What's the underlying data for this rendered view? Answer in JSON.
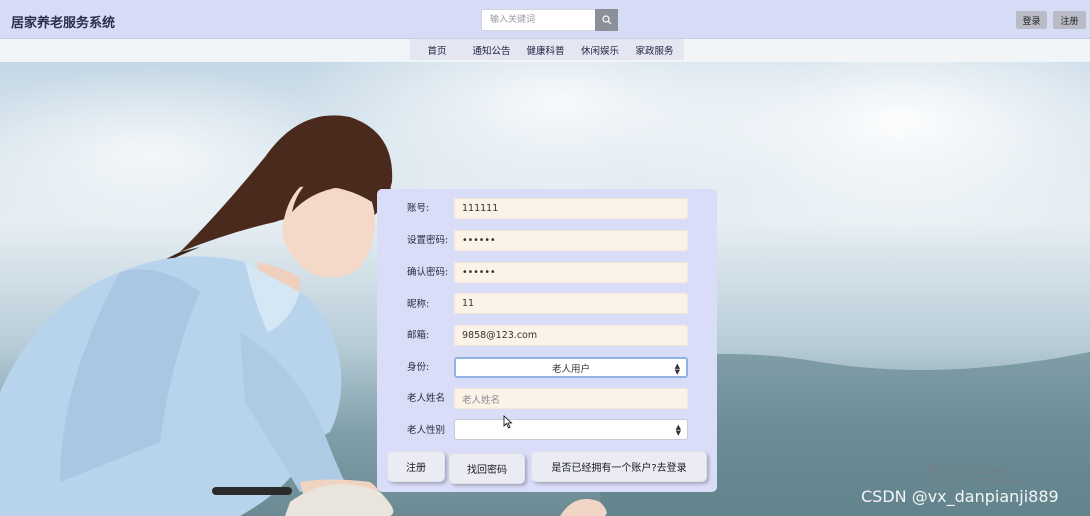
{
  "header": {
    "brand": "居家养老服务系统",
    "search_placeholder": "输入关键词",
    "login_label": "登录",
    "register_label": "注册"
  },
  "nav": {
    "items": [
      {
        "label": "首页"
      },
      {
        "label": "通知公告"
      },
      {
        "label": "健康科普"
      },
      {
        "label": "休闲娱乐"
      },
      {
        "label": "家政服务"
      }
    ]
  },
  "form": {
    "account": {
      "label": "账号:",
      "value": "111111"
    },
    "password": {
      "label": "设置密码:",
      "value": "••••••"
    },
    "confirm_password": {
      "label": "确认密码:",
      "value": "••••••"
    },
    "nickname": {
      "label": "昵称:",
      "value": "11"
    },
    "email": {
      "label": "邮箱:",
      "value": "9858@123.com"
    },
    "identity": {
      "label": "身份:",
      "value": "老人用户"
    },
    "elder_name": {
      "label": "老人姓名",
      "placeholder": "老人姓名"
    },
    "elder_gender": {
      "label": "老人性别",
      "value": ""
    },
    "buttons": {
      "register": "注册",
      "find_password": "找回密码",
      "go_login": "是否已经拥有一个账户?去登录"
    }
  },
  "watermarks": {
    "windows_activate": "激活 Windows",
    "windows_hint": "转到\"设置\"以激活 Windows。",
    "csdn": "CSDN @vx_danpianji889"
  },
  "icons": {
    "search": "search-icon",
    "select_arrows": "select-arrows-icon",
    "cursor": "mouse-cursor-icon"
  }
}
